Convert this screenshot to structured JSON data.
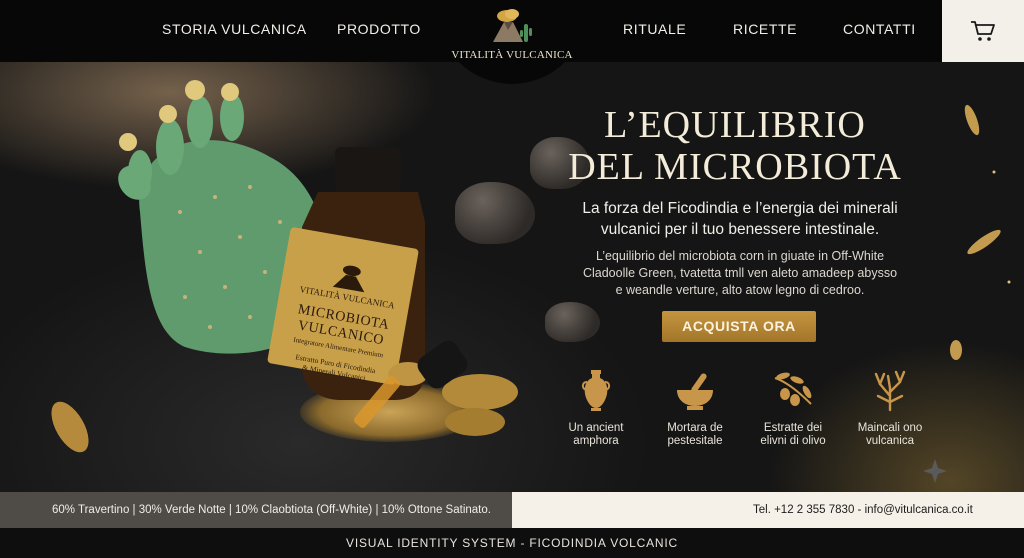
{
  "nav": {
    "links": [
      "STORIA VULCANICA",
      "PRODOTTO",
      "RITUALE",
      "RICETTE",
      "CONTATTI"
    ],
    "logo_text": "VITALITÀ VULCANICA",
    "cart_icon": "cart-icon"
  },
  "hero": {
    "headline_line1": "L’EQUILIBRIO",
    "headline_line2": "DEL MICROBIOTA",
    "subheadline_line1": "La forza del Ficodindia e l’energia dei minerali",
    "subheadline_line2": "vulcanici per il tuo benessere intestinale.",
    "body_line1": "L’equilibrio del microbiota corn in giuate in Off-White",
    "body_line2": "Cladoolle Green, tvatetta tmll ven aleto amadeep abysso",
    "body_line3": "e weandle verture, alto atow legno di cedroo.",
    "cta_label": "ACQUISTA ORA",
    "bottle": {
      "brand": "VITALITÀ VULCANICA",
      "name_line1": "MICROBIOTA",
      "name_line2": "VULCANICO",
      "tagline": "Integratore Alimentare Premium",
      "detail_line1": "Estratto Puro di Ficodindia",
      "detail_line2": "& Minerali Vulcanici"
    },
    "features": [
      {
        "icon": "amphora-icon",
        "line1": "Un ancient",
        "line2": "amphora"
      },
      {
        "icon": "mortar-pestle-icon",
        "line1": "Mortara de",
        "line2": "pestesitale"
      },
      {
        "icon": "olive-branch-icon",
        "line1": "Estratte dei",
        "line2": "elivni di olivo"
      },
      {
        "icon": "volcanic-coral-icon",
        "line1": "Maincali ono",
        "line2": "vulcanica"
      }
    ]
  },
  "palette_text": "60% Travertino | 30% Verde Notte | 10% Claobtiota (Off-White) | 10% Ottone Satinato.",
  "contact_text": "Tel. +12 2 355 7830  -  info@vitulcanica.co.it",
  "footer_text": "VISUAL IDENTITY SYSTEM - FICODINDIA VOLCANIC",
  "colors": {
    "gold": "#b8893a",
    "cactus": "#5e9a6a",
    "nav_bg": "#070707",
    "palette_bar": "#4f4b47",
    "contact_bar": "#f5f1e9"
  }
}
